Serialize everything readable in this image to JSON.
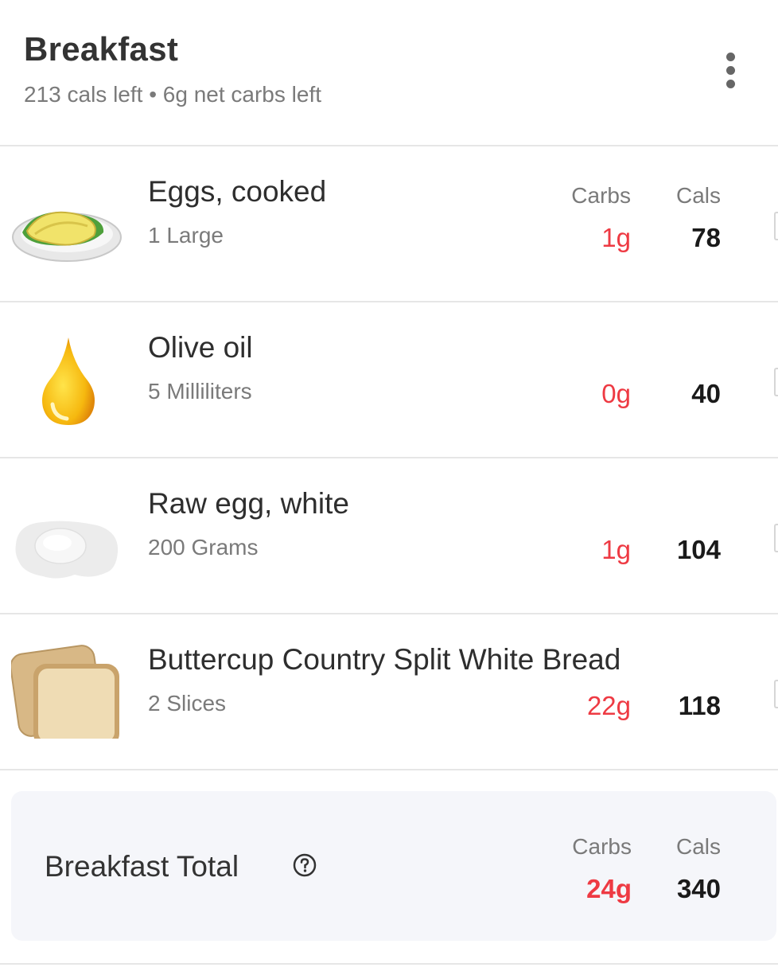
{
  "meal": {
    "title": "Breakfast",
    "subtitle": "213 cals left • 6g net carbs left",
    "menu_icon": "more-vertical-icon"
  },
  "columns": {
    "carbs": "Carbs",
    "cals": "Cals"
  },
  "foods": [
    {
      "name": "Eggs, cooked",
      "serving": "1 Large",
      "carbs": "1g",
      "cals": "78",
      "icon": "fried-egg-icon"
    },
    {
      "name": "Olive oil",
      "serving": "5 Milliliters",
      "carbs": "0g",
      "cals": "40",
      "icon": "oil-drop-icon"
    },
    {
      "name": "Raw egg, white",
      "serving": "200 Grams",
      "carbs": "1g",
      "cals": "104",
      "icon": "raw-egg-icon"
    },
    {
      "name": "Buttercup Country Split White Bread",
      "serving": "2 Slices",
      "carbs": "22g",
      "cals": "118",
      "icon": "bread-icon"
    }
  ],
  "total": {
    "label": "Breakfast Total",
    "carbs_header": "Carbs",
    "cals_header": "Cals",
    "carbs": "24g",
    "cals": "340",
    "help_icon": "question-circle-icon"
  },
  "colors": {
    "carbs": "#ee3a43",
    "title": "#333333",
    "muted": "#7a7a7a",
    "total_bg": "#f5f6fa"
  }
}
